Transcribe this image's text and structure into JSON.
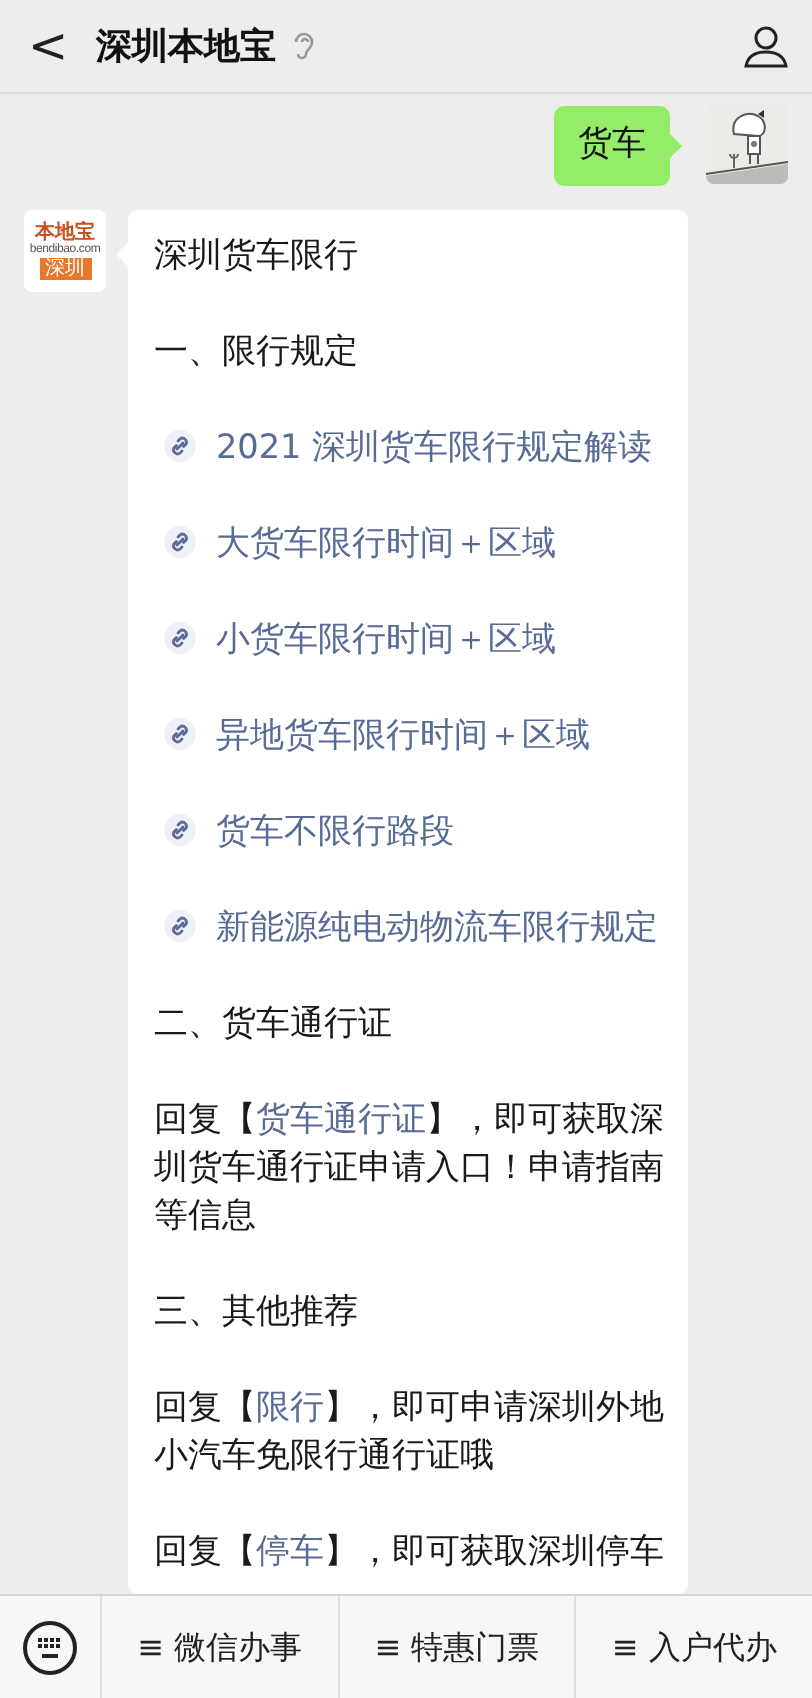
{
  "header": {
    "back": "<",
    "title": "深圳本地宝"
  },
  "messages": [
    {
      "kind": "user",
      "text": "货车"
    },
    {
      "kind": "bot",
      "logo": {
        "brand": "本地宝",
        "site": "bendibao.com",
        "city": "深圳"
      },
      "paragraphs": [
        {
          "kind": "text",
          "text": "深圳货车限行"
        },
        {
          "kind": "text",
          "text": "一、限行规定"
        },
        {
          "kind": "link",
          "text": "2021 深圳货车限行规定解读"
        },
        {
          "kind": "link",
          "text": "大货车限行时间＋区域"
        },
        {
          "kind": "link",
          "text": "小货车限行时间＋区域"
        },
        {
          "kind": "link",
          "text": "异地货车限行时间＋区域"
        },
        {
          "kind": "link",
          "text": "货车不限行路段"
        },
        {
          "kind": "link",
          "text": "新能源纯电动物流车限行规定"
        },
        {
          "kind": "text",
          "text": "二、货车通行证"
        },
        {
          "kind": "reply",
          "before": "回复【",
          "keyword": "货车通行证",
          "after": "】，即可获取深圳货车通行证申请入口！申请指南等信息"
        },
        {
          "kind": "text",
          "text": "三、其他推荐"
        },
        {
          "kind": "reply",
          "before": "回复【",
          "keyword": "限行",
          "after": "】，即可申请深圳外地小汽车免限行通行证哦"
        },
        {
          "kind": "reply",
          "before": "回复【",
          "keyword": "停车",
          "after": "】，即可获取深圳停车"
        }
      ]
    }
  ],
  "menu": [
    {
      "label": "≡ 微信办事"
    },
    {
      "label": "≡ 特惠门票"
    },
    {
      "label": "≡ 入户代办"
    }
  ]
}
